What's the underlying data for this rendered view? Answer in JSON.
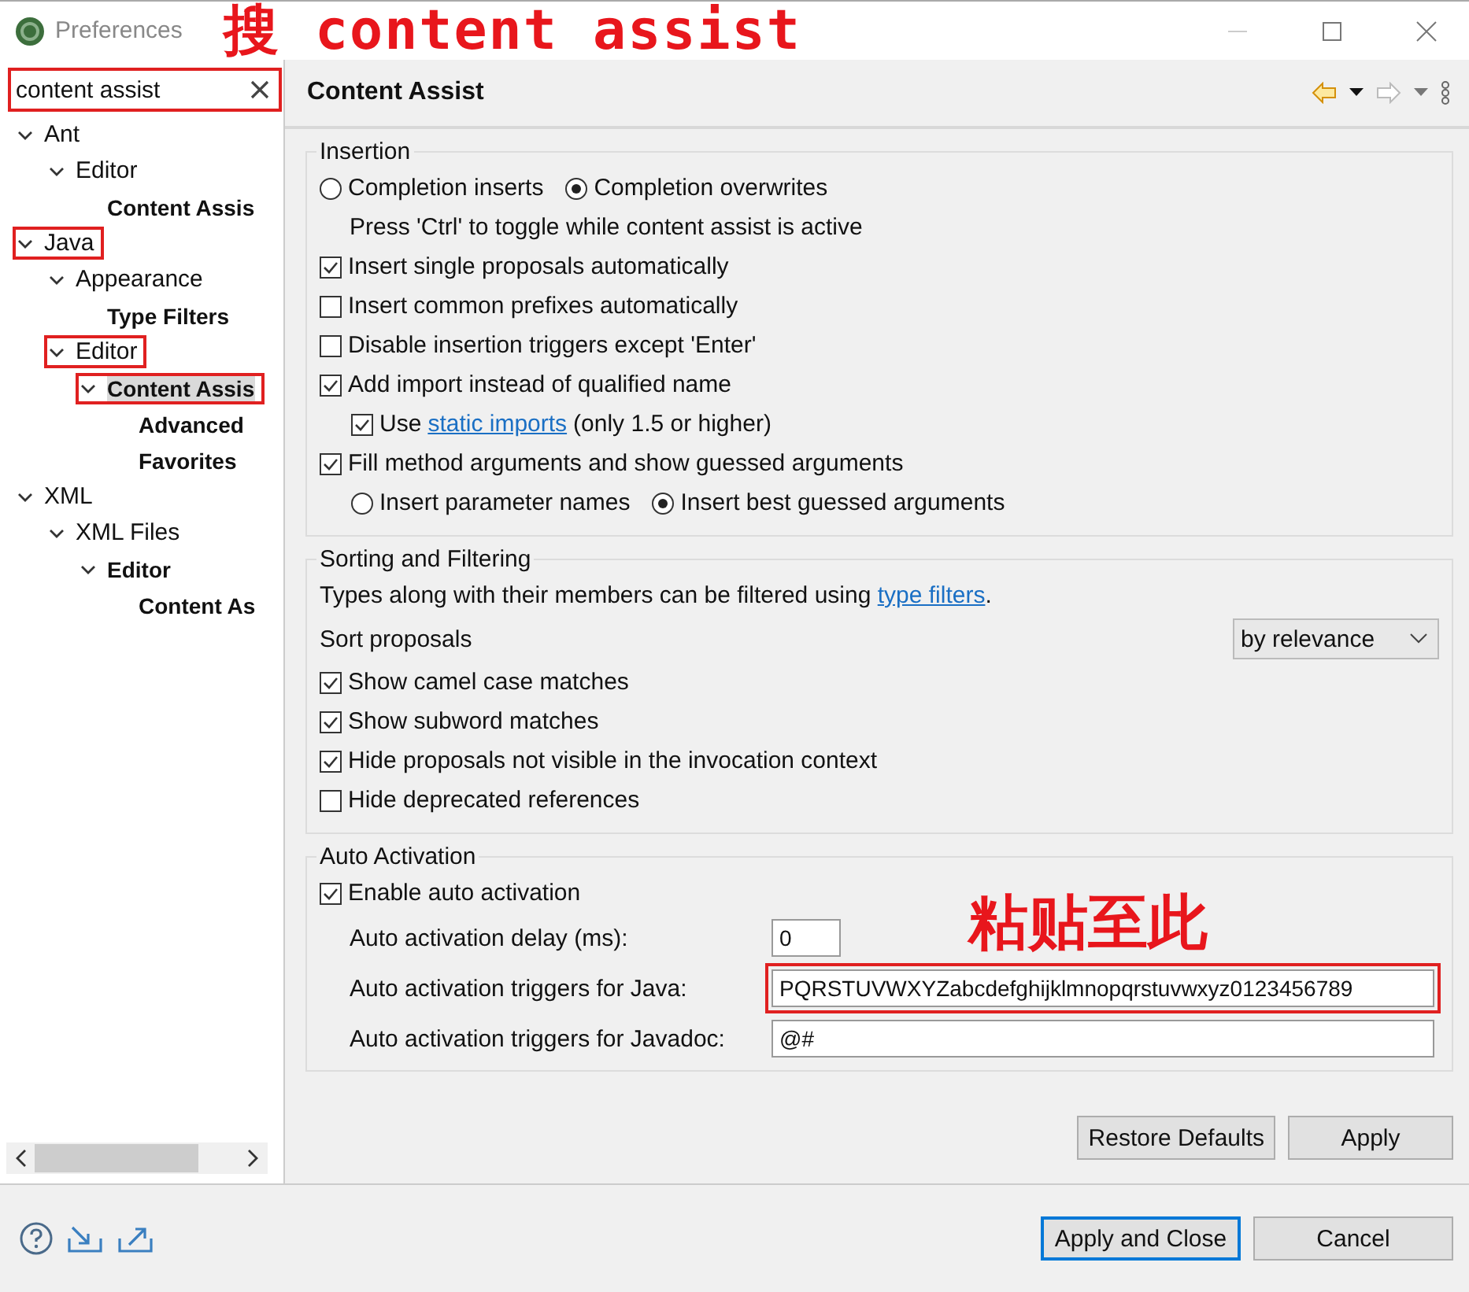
{
  "window": {
    "title": "Preferences"
  },
  "annotations": {
    "search_note": "搜 content assist",
    "paste_note": "粘贴至此"
  },
  "search": {
    "value": "content assist",
    "highlighted": true
  },
  "tree": [
    {
      "label": "Ant",
      "match": false,
      "expanded": true,
      "selected": false,
      "highlighted": false,
      "children": [
        {
          "label": "Editor",
          "match": false,
          "expanded": true,
          "selected": false,
          "highlighted": false,
          "children": [
            {
              "label": "Content Assis",
              "match": true,
              "selected": false,
              "highlighted": false
            }
          ]
        }
      ]
    },
    {
      "label": "Java",
      "match": false,
      "expanded": true,
      "selected": false,
      "highlighted": true,
      "children": [
        {
          "label": "Appearance",
          "match": false,
          "expanded": true,
          "selected": false,
          "highlighted": false,
          "children": [
            {
              "label": "Type Filters",
              "match": true,
              "selected": false,
              "highlighted": false
            }
          ]
        },
        {
          "label": "Editor",
          "match": false,
          "expanded": true,
          "selected": false,
          "highlighted": true,
          "children": [
            {
              "label": "Content Assis",
              "match": true,
              "expanded": true,
              "selected": true,
              "highlighted": true,
              "children": [
                {
                  "label": "Advanced",
                  "match": true,
                  "selected": false,
                  "highlighted": false
                },
                {
                  "label": "Favorites",
                  "match": true,
                  "selected": false,
                  "highlighted": false
                }
              ]
            }
          ]
        }
      ]
    },
    {
      "label": "XML",
      "match": false,
      "expanded": true,
      "selected": false,
      "highlighted": false,
      "children": [
        {
          "label": "XML Files",
          "match": false,
          "expanded": true,
          "selected": false,
          "highlighted": false,
          "children": [
            {
              "label": "Editor",
              "match": true,
              "expanded": true,
              "selected": false,
              "highlighted": false,
              "children": [
                {
                  "label": "Content As",
                  "match": true,
                  "selected": false,
                  "highlighted": false
                }
              ]
            }
          ]
        }
      ]
    }
  ],
  "page": {
    "title": "Content Assist"
  },
  "insertion": {
    "title": "Insertion",
    "rows": [
      {
        "kind": "radios",
        "options": [
          {
            "label": "Completion inserts",
            "selected": false
          },
          {
            "label": "Completion overwrites",
            "selected": true
          }
        ]
      },
      {
        "kind": "note",
        "text": "Press 'Ctrl' to toggle while content assist is active"
      },
      {
        "kind": "checkbox",
        "label": "Insert single proposals automatically",
        "checked": true
      },
      {
        "kind": "checkbox",
        "label": "Insert common prefixes automatically",
        "checked": false
      },
      {
        "kind": "checkbox",
        "label": "Disable insertion triggers except 'Enter'",
        "checked": false
      },
      {
        "kind": "checkbox",
        "label": "Add import instead of qualified name",
        "checked": true,
        "children": [
          {
            "kind": "checkbox",
            "label": "Use",
            "link": "static imports",
            "after": "(only 1.5 or higher)",
            "checked": true
          }
        ]
      },
      {
        "kind": "checkbox",
        "label": "Fill method arguments and show guessed arguments",
        "checked": true,
        "children": [
          {
            "kind": "radios",
            "options": [
              {
                "label": "Insert parameter names",
                "selected": false
              },
              {
                "label": "Insert best guessed arguments",
                "selected": true
              }
            ]
          }
        ]
      }
    ]
  },
  "sorting": {
    "title": "Sorting and Filtering",
    "description": "Types along with their members can be filtered using",
    "link": "type filters",
    "after": ".",
    "sort_label": "Sort proposals",
    "sort_value": "by relevance",
    "checkboxes": [
      {
        "label": "Show camel case matches",
        "checked": true
      },
      {
        "label": "Show subword matches",
        "checked": true
      },
      {
        "label": "Hide proposals not visible in the invocation context",
        "checked": true
      },
      {
        "label": "Hide deprecated references",
        "checked": false
      }
    ]
  },
  "auto_activation": {
    "title": "Auto Activation",
    "enable": {
      "label": "Enable auto activation",
      "checked": true
    },
    "fields": [
      {
        "label": "Auto activation delay (ms):",
        "value": "0",
        "kind": "short",
        "highlighted": false
      },
      {
        "label": "Auto activation triggers for Java:",
        "value": "PQRSTUVWXYZabcdefghijklmnopqrstuvwxyz0123456789",
        "kind": "wide",
        "highlighted": true
      },
      {
        "label": "Auto activation triggers for Javadoc:",
        "value": "@#",
        "kind": "wide",
        "highlighted": false
      }
    ]
  },
  "page_buttons": [
    "Restore Defaults",
    "Apply"
  ],
  "dialog_buttons": [
    {
      "label": "Apply and Close",
      "default": true
    },
    {
      "label": "Cancel",
      "default": false
    }
  ]
}
